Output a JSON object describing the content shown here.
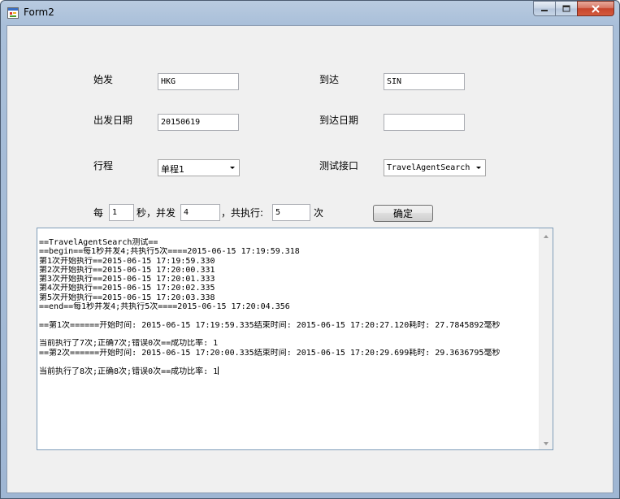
{
  "window": {
    "title": "Form2"
  },
  "form": {
    "depart_label": "始发",
    "depart_value": "HKG",
    "arrive_label": "到达",
    "arrive_value": "SIN",
    "depart_date_label": "出发日期",
    "depart_date_value": "20150619",
    "arrive_date_label": "到达日期",
    "arrive_date_value": "",
    "trip_label": "行程",
    "trip_value": "单程1",
    "interface_label": "测试接口",
    "interface_value": "TravelAgentSearch",
    "every_label": "每",
    "every_value": "1",
    "concurrent_label": "秒，并发",
    "concurrent_value": "4",
    "total_label": "，共执行:",
    "total_value": "5",
    "times_label": "次",
    "confirm_label": "确定"
  },
  "log": {
    "lines": [
      "==TravelAgentSearch测试==",
      "==begin==每1秒并发4;共执行5次====2015-06-15 17:19:59.318",
      "第1次开始执行==2015-06-15 17:19:59.330",
      "第2次开始执行==2015-06-15 17:20:00.331",
      "第3次开始执行==2015-06-15 17:20:01.333",
      "第4次开始执行==2015-06-15 17:20:02.335",
      "第5次开始执行==2015-06-15 17:20:03.338",
      "==end==每1秒并发4;共执行5次====2015-06-15 17:20:04.356",
      "",
      "==第1次======开始时间: 2015-06-15 17:19:59.335结束时间: 2015-06-15 17:20:27.120耗时: 27.7845892毫秒",
      "",
      "当前执行了7次;正确7次;错误0次==成功比率: 1",
      "==第2次======开始时间: 2015-06-15 17:20:00.335结束时间: 2015-06-15 17:20:29.699耗时: 29.3636795毫秒",
      "",
      "当前执行了8次;正确8次;错误0次==成功比率: 1"
    ]
  }
}
